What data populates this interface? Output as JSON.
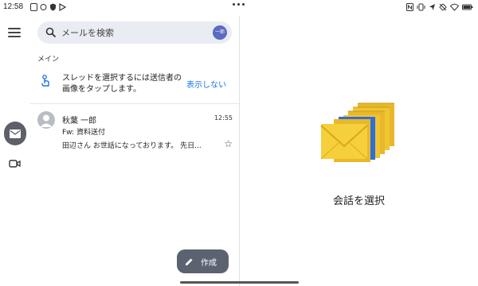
{
  "status_bar": {
    "time": "12:58",
    "left_icons": [
      "assistant-icon",
      "circle-icon",
      "shield-icon",
      "play-icon"
    ],
    "right_icons": [
      "nfc-icon",
      "vibrate-icon",
      "location-icon",
      "rotate-icon",
      "wifi-icon",
      "battery-icon"
    ]
  },
  "search": {
    "placeholder": "メールを検索",
    "account_initial": "一郎"
  },
  "section": {
    "label": "メイン"
  },
  "tip": {
    "text": "スレッドを選択するには送信者の画像をタップします。",
    "action_label": "表示しない"
  },
  "emails": [
    {
      "sender": "秋葉 一郎",
      "time": "12:55",
      "subject": "Fw: 資料送付",
      "snippet": "田辺さん お世話になっております。 先日..."
    }
  ],
  "compose": {
    "label": "作成"
  },
  "detail": {
    "empty_label": "会話を選択"
  },
  "colors": {
    "accent_blue": "#1a73e8",
    "rail_selected": "#5d6066",
    "search_bg": "#e9ecf3",
    "compose_bg": "#5b6270"
  }
}
